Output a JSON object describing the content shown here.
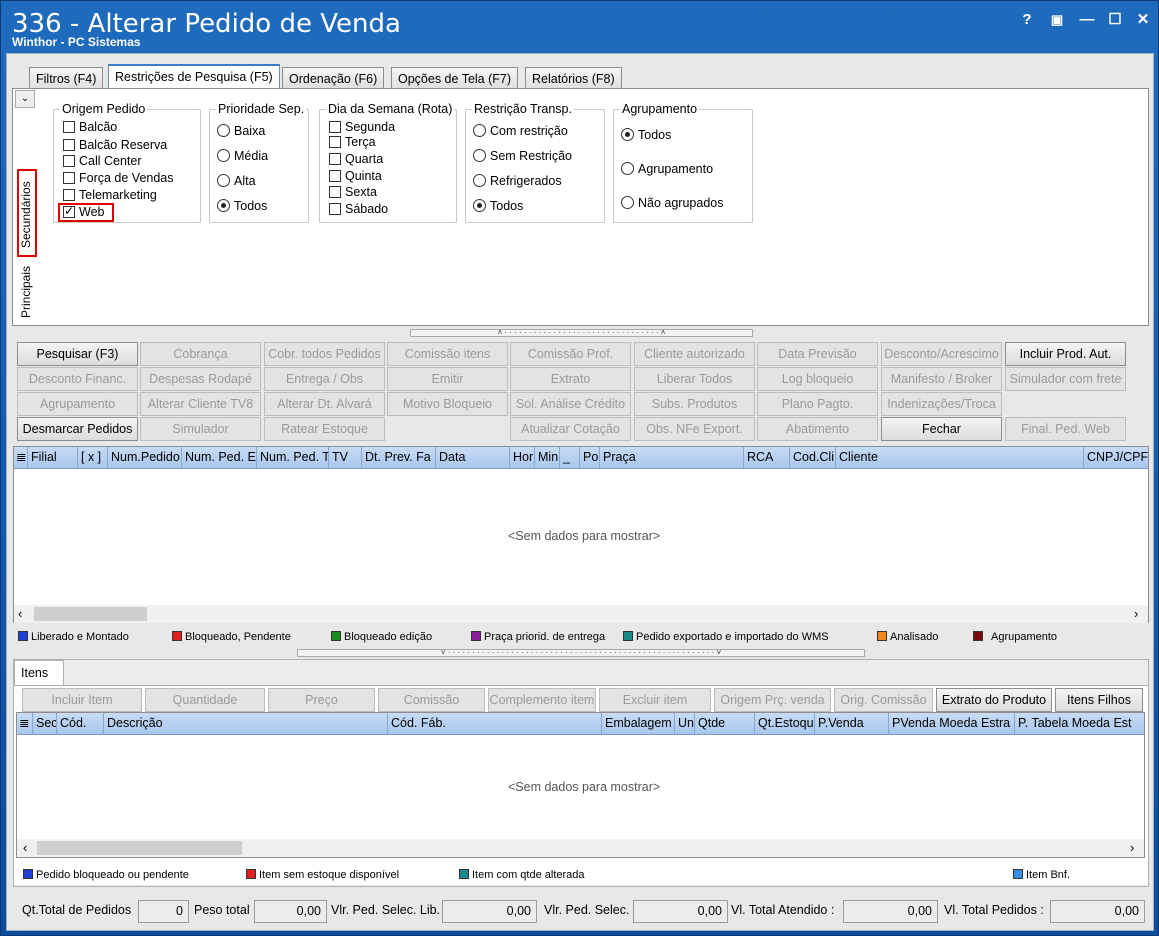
{
  "window": {
    "title": "336 - Alterar Pedido de Venda",
    "subtitle": "Winthor - PC Sistemas",
    "help": "?",
    "restore": "▣",
    "minimize": "—",
    "maximize": "☐",
    "close": "✕"
  },
  "tabs": [
    "Filtros (F4)",
    "Restrições de Pesquisa (F5)",
    "Ordenação (F6)",
    "Opções de Tela (F7)",
    "Relatórios (F8)"
  ],
  "side_tabs": {
    "secundarios": "Secundários",
    "principais": "Principais"
  },
  "groups": {
    "origem": {
      "title": "Origem Pedido",
      "items": [
        {
          "label": "Balcão",
          "checked": false
        },
        {
          "label": "Balcão Reserva",
          "checked": false
        },
        {
          "label": "Call Center",
          "checked": false
        },
        {
          "label": "Força de Vendas",
          "checked": false
        },
        {
          "label": "Telemarketing",
          "checked": false
        },
        {
          "label": "Web",
          "checked": true
        }
      ]
    },
    "prioridade": {
      "title": "Prioridade Sep.",
      "items": [
        {
          "label": "Baixa",
          "checked": false
        },
        {
          "label": "Média",
          "checked": false
        },
        {
          "label": "Alta",
          "checked": false
        },
        {
          "label": "Todos",
          "checked": true
        }
      ]
    },
    "dia": {
      "title": "Dia da Semana (Rota)",
      "items": [
        {
          "label": "Segunda",
          "checked": false
        },
        {
          "label": "Terça",
          "checked": false
        },
        {
          "label": "Quarta",
          "checked": false
        },
        {
          "label": "Quinta",
          "checked": false
        },
        {
          "label": "Sexta",
          "checked": false
        },
        {
          "label": "Sábado",
          "checked": false
        }
      ]
    },
    "restricao": {
      "title": "Restrição Transp.",
      "items": [
        {
          "label": "Com restrição",
          "checked": false
        },
        {
          "label": "Sem Restrição",
          "checked": false
        },
        {
          "label": "Refrigerados",
          "checked": false
        },
        {
          "label": "Todos",
          "checked": true
        }
      ]
    },
    "agrupamento": {
      "title": "Agrupamento",
      "items": [
        {
          "label": "Todos",
          "checked": true
        },
        {
          "label": "Agrupamento",
          "checked": false
        },
        {
          "label": "Não agrupados",
          "checked": false
        }
      ]
    }
  },
  "buttons": [
    [
      "Pesquisar (F3)",
      "Cobrança",
      "Cobr. todos Pedidos",
      "Comissão itens",
      "Comissão Prof.",
      "Cliente autorizado",
      "Data Previsão",
      "Desconto/Acrescimo",
      "Incluir Prod. Aut."
    ],
    [
      "Desconto Financ.",
      "Despesas Rodapé",
      "Entrega / Obs",
      "Emitir",
      "Extrato",
      "Liberar Todos",
      "Log bloqueio",
      "Manifesto / Broker",
      "Simulador com frete"
    ],
    [
      "Agrupamento",
      "Alterar Cliente TV8",
      "Alterar Dt. Alvará",
      "Motivo Bloqueio",
      "Sol. Análise Crédito",
      "Subs. Produtos",
      "Plano Pagto.",
      "Indenizações/Troca",
      ""
    ],
    [
      "Desmarcar Pedidos",
      "Simulador",
      "Ratear Estoque",
      "",
      "Atualizar Cotação",
      "Obs. NFe Export.",
      "Abatimento",
      "Fechar",
      "Final. Ped. Web"
    ]
  ],
  "orders_grid": {
    "columns": [
      "Filial",
      "[ x ]",
      "Num.Pedido",
      "Num. Ped. E",
      "Num. Ped. T",
      "TV",
      "Dt. Prev. Fa",
      "Data",
      "Hor",
      "Min",
      "_",
      "Po",
      "Praça",
      "RCA",
      "Cod.Cli",
      "Cliente",
      "CNPJ/CPF"
    ],
    "empty": "<Sem dados para mostrar>"
  },
  "legend_top": [
    {
      "label": "Liberado e Montado",
      "color": "#1f3fd6"
    },
    {
      "label": "Bloqueado, Pendente",
      "color": "#e02020"
    },
    {
      "label": "Bloqueado edição",
      "color": "#1c8a1c"
    },
    {
      "label": "Praça priorid. de entrega",
      "color": "#8a1c9a"
    },
    {
      "label": "Pedido exportado e importado do WMS",
      "color": "#1a8a8a"
    },
    {
      "label": "Analisado",
      "color": "#f08a1a"
    },
    {
      "label": "Agrupamento",
      "color": "#7a0c0c"
    }
  ],
  "items_tab": "Itens",
  "item_buttons": [
    "Incluir Item",
    "Quantidade",
    "Preço",
    "Comissão",
    "Complemento item",
    "Excluir item",
    "Origem Prç. venda",
    "Orig. Comissão",
    "Extrato do Produto",
    "Itens Filhos"
  ],
  "items_grid": {
    "columns": [
      "Sec",
      "Cód.",
      "Descrição",
      "Cód. Fáb.",
      "Embalagem",
      "Un",
      "Qtde",
      "Qt.Estoqu",
      "P.Venda",
      "PVenda Moeda Estra",
      "P. Tabela Moeda Est"
    ],
    "empty": "<Sem dados para mostrar>"
  },
  "legend_bottom": [
    {
      "label": "Pedido bloqueado ou pendente",
      "color": "#1f3fd6"
    },
    {
      "label": "Item sem estoque disponível",
      "color": "#e02020"
    },
    {
      "label": "Item com qtde alterada",
      "color": "#1a8a8a"
    },
    {
      "label": "Item Bnf.",
      "color": "#3a8ee8"
    }
  ],
  "totals": {
    "qt_label": "Qt.Total de Pedidos",
    "qt_value": "0",
    "peso_label": "Peso total",
    "peso_value": "0,00",
    "lib_label": "Vlr. Ped. Selec. Lib.",
    "lib_value": "0,00",
    "selec_label": "Vlr. Ped. Selec.",
    "selec_value": "0,00",
    "atendido_label": "Vl. Total Atendido :",
    "atendido_value": "0,00",
    "pedidos_label": "Vl. Total Pedidos :",
    "pedidos_value": "0,00"
  }
}
